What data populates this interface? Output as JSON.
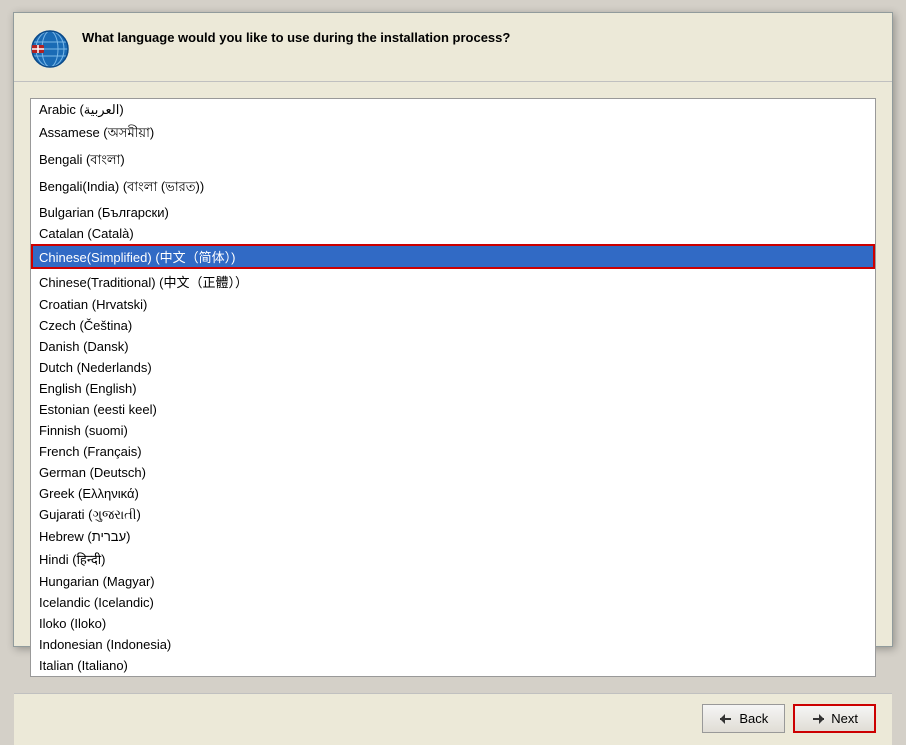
{
  "dialog": {
    "title": "What language would you like to use during the\ninstallation process?"
  },
  "languages": [
    "Arabic (العربية)",
    "Assamese (অসমীয়া)",
    "Bengali (বাংলা)",
    "Bengali(India) (বাংলা (ভারত))",
    "Bulgarian (Български)",
    "Catalan (Català)",
    "Chinese(Simplified) (中文（简体）)",
    "Chinese(Traditional) (中文（正體））",
    "Croatian (Hrvatski)",
    "Czech (Čeština)",
    "Danish (Dansk)",
    "Dutch (Nederlands)",
    "English (English)",
    "Estonian (eesti keel)",
    "Finnish (suomi)",
    "French (Français)",
    "German (Deutsch)",
    "Greek (Ελληνικά)",
    "Gujarati (ગુજરાતી)",
    "Hebrew (עברית)",
    "Hindi (हिन्दी)",
    "Hungarian (Magyar)",
    "Icelandic (Icelandic)",
    "Iloko (Iloko)",
    "Indonesian (Indonesia)",
    "Italian (Italiano)"
  ],
  "selected_index": 6,
  "buttons": {
    "back": "Back",
    "next": "Next"
  }
}
